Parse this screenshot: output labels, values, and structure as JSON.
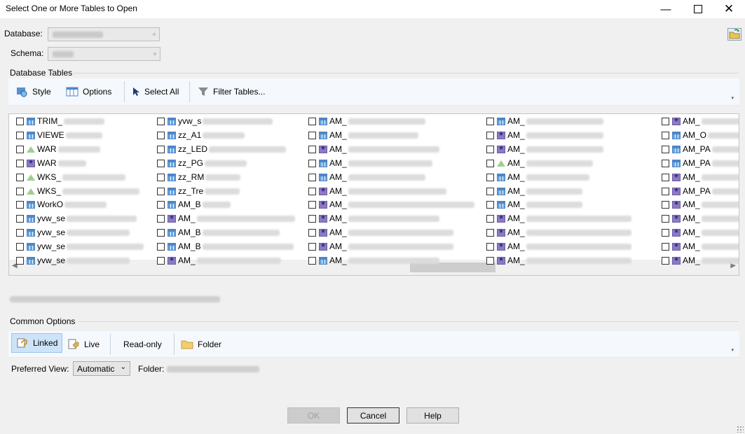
{
  "window": {
    "title": "Select One or More Tables to Open"
  },
  "form": {
    "database_label": "Database:",
    "schema_label": "Schema:"
  },
  "tables_section": {
    "label": "Database Tables",
    "toolbar": {
      "style": "Style",
      "options": "Options",
      "select_all": "Select All",
      "filter": "Filter Tables..."
    },
    "columns": [
      {
        "items": [
          {
            "prefix": "TRIM_",
            "icon": "table"
          },
          {
            "prefix": "VIEWE",
            "icon": "table"
          },
          {
            "prefix": "WAR",
            "icon": "shape"
          },
          {
            "prefix": "WAR",
            "icon": "view"
          },
          {
            "prefix": "WKS_",
            "icon": "shape"
          },
          {
            "prefix": "WKS_",
            "icon": "shape"
          },
          {
            "prefix": "WorkO",
            "icon": "table"
          },
          {
            "prefix": "yvw_se",
            "icon": "table"
          },
          {
            "prefix": "yvw_se",
            "icon": "table"
          },
          {
            "prefix": "yvw_se",
            "icon": "table"
          },
          {
            "prefix": "yvw_se",
            "icon": "table"
          }
        ]
      },
      {
        "items": [
          {
            "prefix": "yvw_s",
            "icon": "table"
          },
          {
            "prefix": "zz_A1",
            "icon": "table"
          },
          {
            "prefix": "zz_LED",
            "icon": "table"
          },
          {
            "prefix": "zz_PG",
            "icon": "table"
          },
          {
            "prefix": "zz_RM",
            "icon": "table"
          },
          {
            "prefix": "zz_Tre",
            "icon": "table"
          },
          {
            "prefix": "AM_B",
            "icon": "table"
          },
          {
            "prefix": "AM_",
            "icon": "view"
          },
          {
            "prefix": "AM_B",
            "icon": "table"
          },
          {
            "prefix": "AM_B",
            "icon": "table"
          },
          {
            "prefix": "AM_",
            "icon": "view"
          }
        ]
      },
      {
        "items": [
          {
            "prefix": "AM_",
            "icon": "table"
          },
          {
            "prefix": "AM_",
            "icon": "table"
          },
          {
            "prefix": "AM_",
            "icon": "view"
          },
          {
            "prefix": "AM_",
            "icon": "table"
          },
          {
            "prefix": "AM_",
            "icon": "table"
          },
          {
            "prefix": "AM_",
            "icon": "view"
          },
          {
            "prefix": "AM_",
            "icon": "view"
          },
          {
            "prefix": "AM_",
            "icon": "view"
          },
          {
            "prefix": "AM_",
            "icon": "view"
          },
          {
            "prefix": "AM_",
            "icon": "view"
          },
          {
            "prefix": "AM_",
            "icon": "table"
          }
        ]
      },
      {
        "items": [
          {
            "prefix": "AM_",
            "icon": "table"
          },
          {
            "prefix": "AM_",
            "icon": "view"
          },
          {
            "prefix": "AM_",
            "icon": "view"
          },
          {
            "prefix": "AM_",
            "icon": "shape"
          },
          {
            "prefix": "AM_",
            "icon": "table"
          },
          {
            "prefix": "AM_",
            "icon": "table"
          },
          {
            "prefix": "AM_",
            "icon": "table"
          },
          {
            "prefix": "AM_",
            "icon": "view"
          },
          {
            "prefix": "AM_",
            "icon": "view"
          },
          {
            "prefix": "AM_",
            "icon": "view"
          },
          {
            "prefix": "AM_",
            "icon": "view"
          }
        ]
      },
      {
        "items": [
          {
            "prefix": "AM_",
            "icon": "view"
          },
          {
            "prefix": "AM_O",
            "icon": "table"
          },
          {
            "prefix": "AM_PA",
            "icon": "table"
          },
          {
            "prefix": "AM_PA",
            "icon": "table"
          },
          {
            "prefix": "AM_",
            "icon": "view"
          },
          {
            "prefix": "AM_PA",
            "icon": "view"
          },
          {
            "prefix": "AM_",
            "icon": "view"
          },
          {
            "prefix": "AM_",
            "icon": "view"
          },
          {
            "prefix": "AM_",
            "icon": "view"
          },
          {
            "prefix": "AM_",
            "icon": "view"
          },
          {
            "prefix": "AM_",
            "icon": "view"
          }
        ]
      }
    ]
  },
  "common_options": {
    "label": "Common Options",
    "toolbar": {
      "linked": "Linked",
      "live": "Live",
      "read_only": "Read-only",
      "folder": "Folder"
    },
    "preferred_view_label": "Preferred View:",
    "preferred_view_value": "Automatic",
    "folder_label": "Folder:"
  },
  "buttons": {
    "ok": "OK",
    "cancel": "Cancel",
    "help": "Help"
  },
  "colors": {
    "selected_bg": "#cde3f8",
    "toolbar_bg": "#f5f8fc"
  }
}
